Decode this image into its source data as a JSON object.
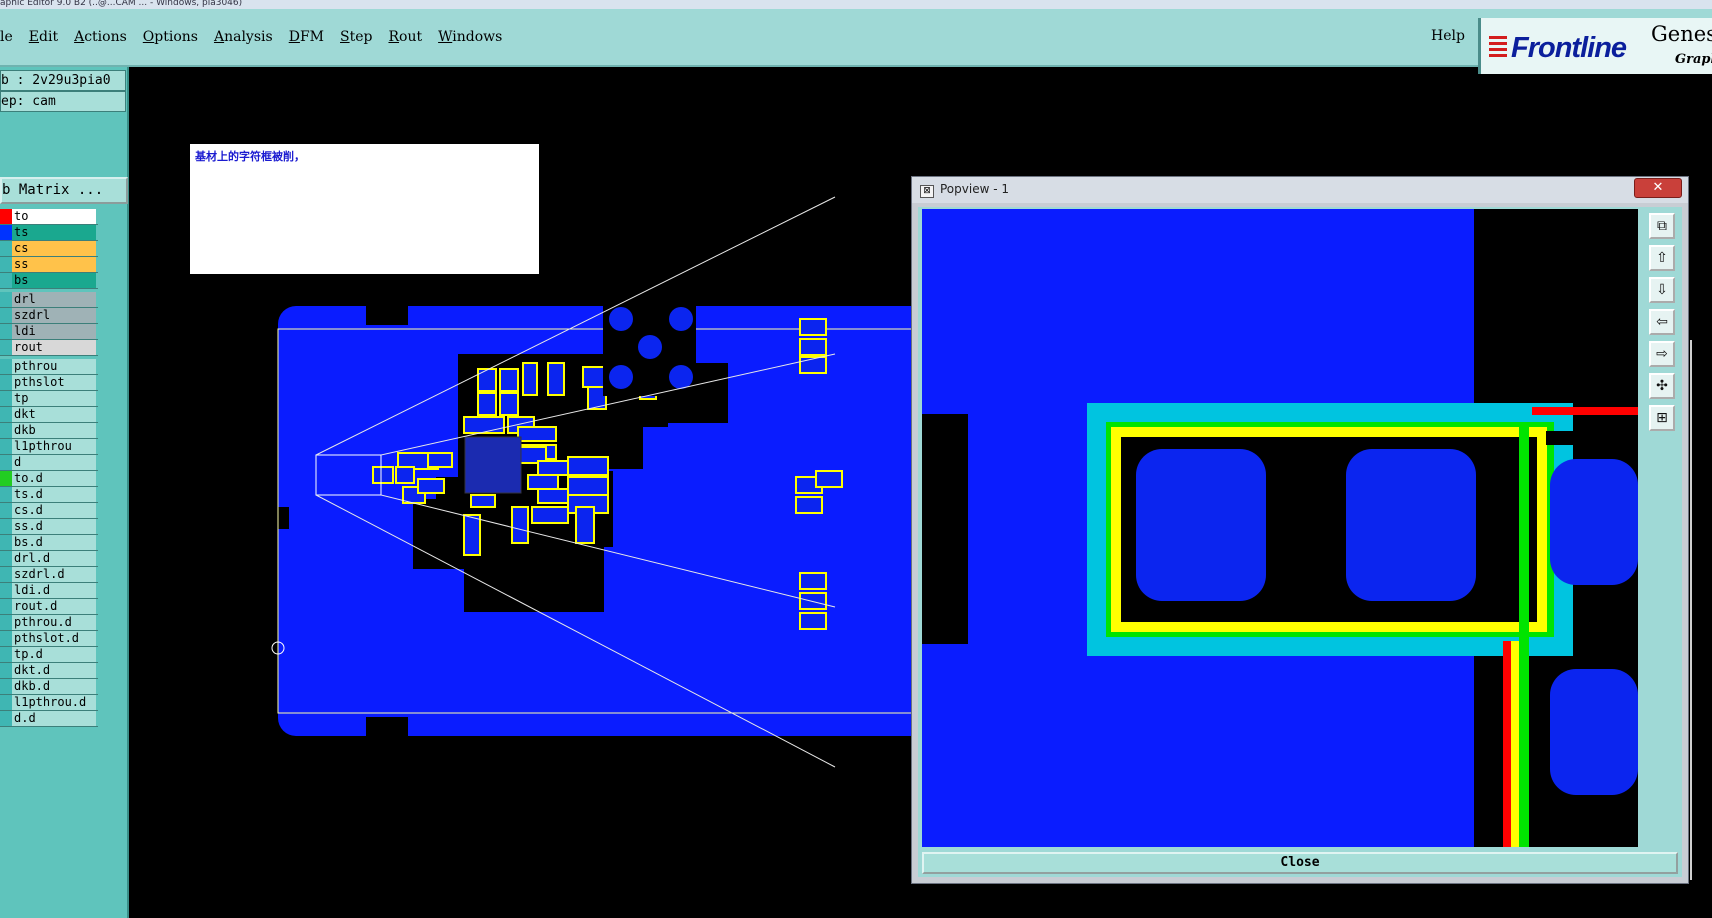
{
  "window": {
    "title_fragment": "aphic Editor 9.0 B2 (..@...CAM ...  - Windows, pla3046)"
  },
  "menubar": {
    "items": [
      "le",
      "Edit",
      "Actions",
      "Options",
      "Analysis",
      "DFM",
      "Step",
      "Rout",
      "Windows"
    ],
    "help": "Help"
  },
  "logo": {
    "brand": "Frontline",
    "product": "Genes",
    "sub": "Graphi"
  },
  "sidebar": {
    "job": "b : 2v29u3pia0",
    "step": "ep: cam",
    "matrix_button": "b Matrix ...",
    "layers": [
      {
        "name": "to",
        "swatch": "#ff0000",
        "bg": "#ffffff"
      },
      {
        "name": "ts",
        "swatch": "#0033ff",
        "bg": "#1aa88f"
      },
      {
        "name": "cs",
        "swatch": "#3fb6b3",
        "bg": "#ffc24a"
      },
      {
        "name": "ss",
        "swatch": "#3fb6b3",
        "bg": "#ffc24a"
      },
      {
        "name": "bs",
        "swatch": "#3fb6b3",
        "bg": "#1aa88f"
      },
      {
        "name": "drl",
        "swatch": "#3fb6b3",
        "bg": "#9fb2b6"
      },
      {
        "name": "szdrl",
        "swatch": "#3fb6b3",
        "bg": "#9fb2b6"
      },
      {
        "name": "ldi",
        "swatch": "#3fb6b3",
        "bg": "#9fb2b6"
      },
      {
        "name": "rout",
        "swatch": "#3fb6b3",
        "bg": "#d8d8d8"
      },
      {
        "name": "pthrou",
        "swatch": "#3fb6b3",
        "bg": "#a8dfd9"
      },
      {
        "name": "pthslot",
        "swatch": "#3fb6b3",
        "bg": "#a8dfd9"
      },
      {
        "name": "tp",
        "swatch": "#3fb6b3",
        "bg": "#a8dfd9"
      },
      {
        "name": "dkt",
        "swatch": "#3fb6b3",
        "bg": "#a8dfd9"
      },
      {
        "name": "dkb",
        "swatch": "#3fb6b3",
        "bg": "#a8dfd9"
      },
      {
        "name": "l1pthrou",
        "swatch": "#3fb6b3",
        "bg": "#a8dfd9"
      },
      {
        "name": "d",
        "swatch": "#3fb6b3",
        "bg": "#a8dfd9"
      },
      {
        "name": "to.d",
        "swatch": "#22cc22",
        "bg": "#a8dfd9"
      },
      {
        "name": "ts.d",
        "swatch": "#3fb6b3",
        "bg": "#a8dfd9"
      },
      {
        "name": "cs.d",
        "swatch": "#3fb6b3",
        "bg": "#a8dfd9"
      },
      {
        "name": "ss.d",
        "swatch": "#3fb6b3",
        "bg": "#a8dfd9"
      },
      {
        "name": "bs.d",
        "swatch": "#3fb6b3",
        "bg": "#a8dfd9"
      },
      {
        "name": "drl.d",
        "swatch": "#3fb6b3",
        "bg": "#a8dfd9"
      },
      {
        "name": "szdrl.d",
        "swatch": "#3fb6b3",
        "bg": "#a8dfd9"
      },
      {
        "name": "ldi.d",
        "swatch": "#3fb6b3",
        "bg": "#a8dfd9"
      },
      {
        "name": "rout.d",
        "swatch": "#3fb6b3",
        "bg": "#a8dfd9"
      },
      {
        "name": "pthrou.d",
        "swatch": "#3fb6b3",
        "bg": "#a8dfd9"
      },
      {
        "name": "pthslot.d",
        "swatch": "#3fb6b3",
        "bg": "#a8dfd9"
      },
      {
        "name": "tp.d",
        "swatch": "#3fb6b3",
        "bg": "#a8dfd9"
      },
      {
        "name": "dkt.d",
        "swatch": "#3fb6b3",
        "bg": "#a8dfd9"
      },
      {
        "name": "dkb.d",
        "swatch": "#3fb6b3",
        "bg": "#a8dfd9"
      },
      {
        "name": "l1pthrou.d",
        "swatch": "#3fb6b3",
        "bg": "#a8dfd9"
      },
      {
        "name": "d.d",
        "swatch": "#3fb6b3",
        "bg": "#a8dfd9"
      }
    ]
  },
  "note": {
    "text": "基材上的字符框被削，"
  },
  "popview": {
    "title": "Popview - 1",
    "close_x": "✕",
    "close_button": "Close",
    "tools": [
      "zoom-window-icon",
      "pan-up-icon",
      "pan-down-icon",
      "pan-left-icon",
      "pan-right-icon",
      "zoom-fit-icon",
      "zoom-center-icon"
    ]
  },
  "colors": {
    "board": "#0a1cff",
    "outline": "#ffff00",
    "menubar": "#9fd9d6",
    "sidebar": "#5fc4bc",
    "pad_blue": "#0b25ef",
    "trace_green": "#00e400",
    "trace_cyan": "#00c4e0",
    "trace_red": "#ff0000"
  }
}
